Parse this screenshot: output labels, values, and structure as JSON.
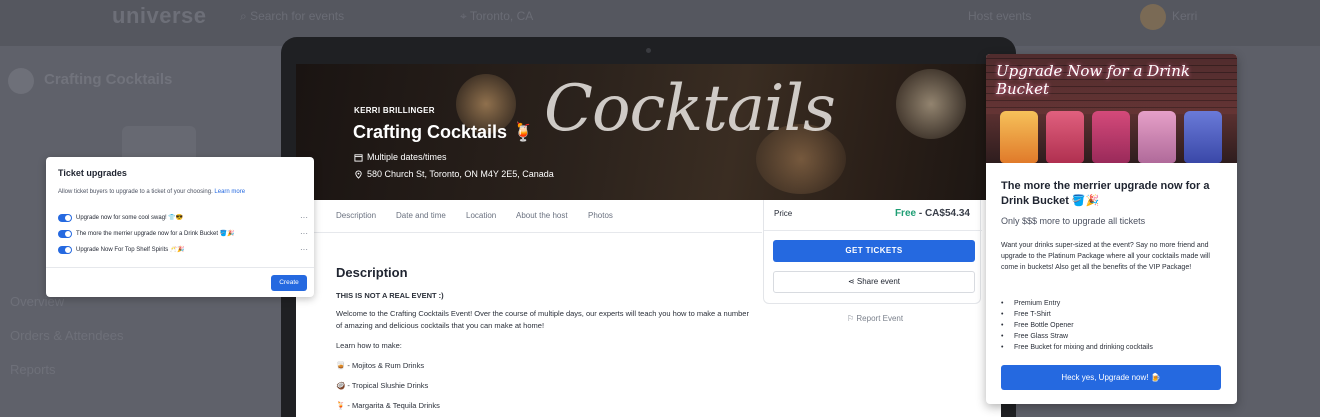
{
  "background": {
    "logo": "universe",
    "search_placeholder": "Search for events",
    "location": "Toronto, CA",
    "host_events": "Host events",
    "account": "Kerri",
    "event_name": "Crafting Cocktails",
    "menu": [
      "Overview",
      "Orders & Attendees",
      "Reports"
    ]
  },
  "hero": {
    "host": "KERRI BRILLINGER",
    "title": "Crafting Cocktails 🍹",
    "dates": "Multiple dates/times",
    "address": "580 Church St, Toronto, ON M4Y 2E5, Canada",
    "script": "Cocktails"
  },
  "tabs": [
    "Description",
    "Date and time",
    "Location",
    "About the host",
    "Photos"
  ],
  "price_card": {
    "label": "Price",
    "free": "Free",
    "price": " - CA$54.34",
    "get_tickets": "GET TICKETS",
    "share": "Share event",
    "report": "Report Event"
  },
  "description": {
    "heading": "Description",
    "not_real": "THIS IS NOT A REAL EVENT :)",
    "intro": "Welcome to the Crafting Cocktails Event! Over the course of multiple days, our experts will teach you how to make a number of amazing and delicious cocktails that you can make at home!",
    "learn": "Learn how to make:",
    "items": [
      "🥃 - Mojitos & Rum Drinks",
      "🥥 - Tropical Slushie Drinks",
      "🍹 - Margarita & Tequila Drinks"
    ]
  },
  "ticket_upgrades": {
    "title": "Ticket upgrades",
    "subtitle": "Allow ticket buyers to upgrade to a ticket of your choosing.",
    "learn_more": "Learn more",
    "items": [
      "Upgrade now for some cool swag! 👕😎",
      "The more the merrier upgrade now for a Drink Bucket 🪣🎉",
      "Upgrade Now For Top Shelf Spirits 🥂🎉"
    ],
    "create": "Create"
  },
  "upgrade_popup": {
    "image_text": "Upgrade Now for a Drink Bucket",
    "title": "The more the merrier upgrade now for a Drink Bucket 🪣🎉",
    "subtitle": "Only $$$ more to upgrade all tickets",
    "description": "Want your drinks super-sized at the event? Say no more friend and upgrade to the Platinum Package where all your cocktails made will come in buckets! Also get all the benefits of the VIP Package!",
    "benefits": [
      "Premium Entry",
      "Free T-Shirt",
      "Free Bottle Opener",
      "Free Glass Straw",
      "Free Bucket for mixing and drinking cocktails"
    ],
    "cta": "Heck yes, Upgrade now! 🍺"
  },
  "colors": {
    "primary": "#2569e0",
    "free_green": "#1f9e74",
    "overlay": "#5d5f68"
  }
}
